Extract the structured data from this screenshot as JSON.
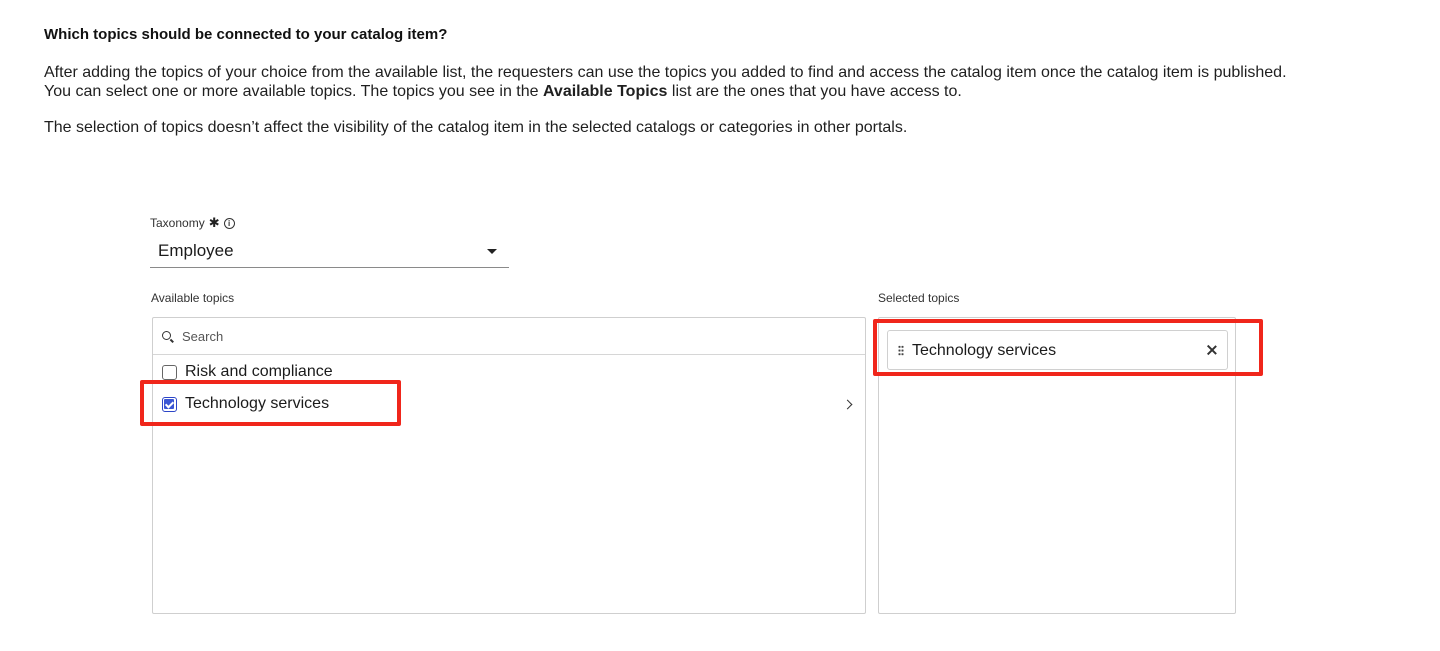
{
  "heading": "Which topics should be connected to your catalog item?",
  "paragraph1": {
    "before": "After adding the topics of your choice from the available list, the requesters can use the topics you added to find and access the catalog item once the catalog item is published. You can select one or more available topics. The topics you see in the ",
    "bold": "Available Topics",
    "after": " list are the ones that you have access to."
  },
  "paragraph2": "The selection of topics doesn’t affect the visibility of the catalog item in the selected catalogs or categories in other portals.",
  "taxonomy": {
    "label": "Taxonomy",
    "required_icon": "required-asterisk-icon",
    "info_icon": "info-icon",
    "value": "Employee"
  },
  "available": {
    "label": "Available topics",
    "search_placeholder": "Search",
    "items": [
      {
        "label": "Risk and compliance",
        "checked": false
      },
      {
        "label": "Technology services",
        "checked": true,
        "has_children": true
      }
    ]
  },
  "selected": {
    "label": "Selected topics",
    "items": [
      {
        "label": "Technology services"
      }
    ]
  },
  "colors": {
    "highlight": "#f0261b",
    "checkbox_checked": "#3a56d4"
  }
}
